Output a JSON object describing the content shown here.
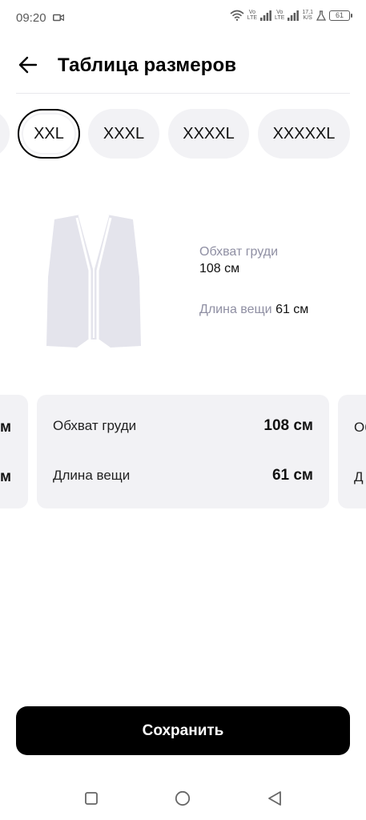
{
  "status_bar": {
    "time": "09:20",
    "net1": "Vo\nLTE",
    "net2": "Vo\nLTE",
    "speed": "17,1\nK/S",
    "battery": "61"
  },
  "header": {
    "title": "Таблица размеров"
  },
  "sizes": [
    {
      "label": "XXL",
      "selected": true
    },
    {
      "label": "XXXL",
      "selected": false
    },
    {
      "label": "XXXXL",
      "selected": false
    },
    {
      "label": "XXXXXL",
      "selected": false
    }
  ],
  "illustration": {
    "chest_label": "Обхват груди",
    "chest_value": "108 см",
    "length_label": "Длина вещи",
    "length_value": "61 см"
  },
  "prev_card": {
    "row1_value_tail": "м",
    "row2_value_tail": "м"
  },
  "card": {
    "rows": [
      {
        "label": "Обхват груди",
        "value": "108 см"
      },
      {
        "label": "Длина вещи",
        "value": "61 см"
      }
    ]
  },
  "next_card": {
    "row1_label_head": "Об",
    "row2_label_head": "Д"
  },
  "save_label": "Сохранить",
  "colors": {
    "accent": "#000000",
    "chip_bg": "#f2f2f5",
    "muted_label": "#8f8fa3"
  }
}
